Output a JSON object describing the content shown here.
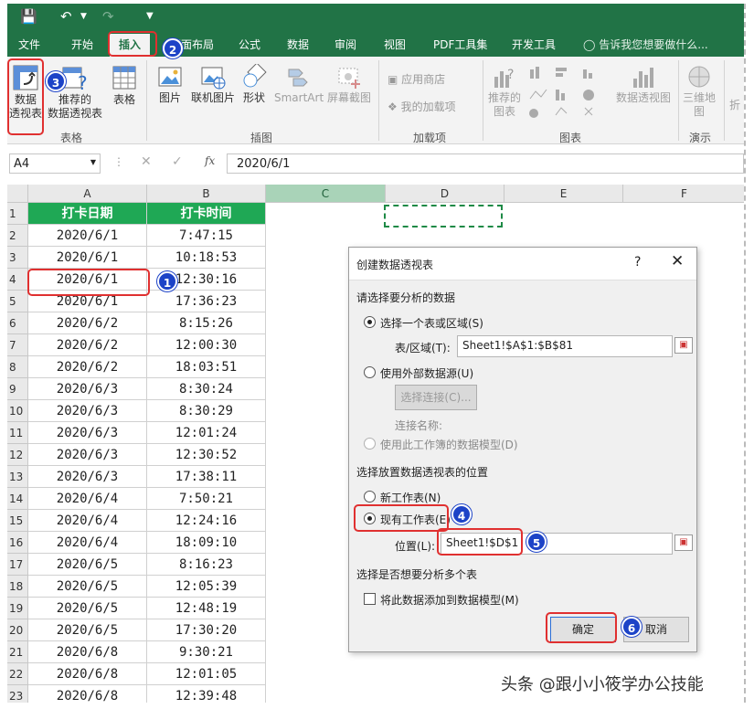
{
  "ribbon_tabs": [
    "文件",
    "开始",
    "插入",
    "页面布局",
    "公式",
    "数据",
    "审阅",
    "视图",
    "PDF工具集",
    "开发工具"
  ],
  "tell_me": "告诉我您想要做什么...",
  "ribbon": {
    "pivot": [
      "数据",
      "透视表"
    ],
    "recommended_pivot": [
      "推荐的",
      "数据透视表"
    ],
    "table": "表格",
    "group_tables": "表格",
    "picture": "图片",
    "online_picture": "联机图片",
    "shapes": "形状",
    "smartart": "SmartArt",
    "screenshot": "屏幕截图",
    "group_illustrations": "插图",
    "store": "应用商店",
    "my_addins": "我的加载项",
    "group_addins": "加载项",
    "rec_charts": [
      "推荐的",
      "图表"
    ],
    "pivot_chart": "数据透视图",
    "group_charts": "图表",
    "map3d": [
      "三维地",
      "图"
    ],
    "group_tours": "演示",
    "fold": "折"
  },
  "name_box": "A4",
  "formula": "2020/6/1",
  "columns": [
    "A",
    "B",
    "C",
    "D",
    "E",
    "F"
  ],
  "header_row": [
    "打卡日期",
    "打卡时间"
  ],
  "rows": [
    [
      "2020/6/1",
      "7:47:15"
    ],
    [
      "2020/6/1",
      "10:18:53"
    ],
    [
      "2020/6/1",
      "12:30:16"
    ],
    [
      "2020/6/1",
      "17:36:23"
    ],
    [
      "2020/6/2",
      "8:15:26"
    ],
    [
      "2020/6/2",
      "12:00:30"
    ],
    [
      "2020/6/2",
      "18:03:51"
    ],
    [
      "2020/6/3",
      "8:30:24"
    ],
    [
      "2020/6/3",
      "8:30:29"
    ],
    [
      "2020/6/3",
      "12:01:24"
    ],
    [
      "2020/6/3",
      "12:30:52"
    ],
    [
      "2020/6/3",
      "17:38:11"
    ],
    [
      "2020/6/4",
      "7:50:21"
    ],
    [
      "2020/6/4",
      "12:24:16"
    ],
    [
      "2020/6/4",
      "18:09:10"
    ],
    [
      "2020/6/5",
      "8:16:23"
    ],
    [
      "2020/6/5",
      "12:05:39"
    ],
    [
      "2020/6/5",
      "12:48:19"
    ],
    [
      "2020/6/5",
      "17:30:20"
    ],
    [
      "2020/6/8",
      "9:30:21"
    ],
    [
      "2020/6/8",
      "12:01:05"
    ],
    [
      "2020/6/8",
      "12:39:48"
    ]
  ],
  "row_numbers": [
    "1",
    "2",
    "3",
    "4",
    "5",
    "6",
    "7",
    "8",
    "9",
    "10",
    "11",
    "12",
    "13",
    "14",
    "15",
    "16",
    "17",
    "18",
    "19",
    "20",
    "21",
    "22",
    "23"
  ],
  "dialog": {
    "title": "创建数据透视表",
    "help": "?",
    "close": "✕",
    "section1": "请选择要分析的数据",
    "opt_range": "选择一个表或区域(S)",
    "range_label": "表/区域(T):",
    "range_value": "Sheet1!$A$1:$B$81",
    "opt_external": "使用外部数据源(U)",
    "choose_conn": "选择连接(C)...",
    "conn_name": "连接名称:",
    "opt_model": "使用此工作簿的数据模型(D)",
    "section2": "选择放置数据透视表的位置",
    "opt_new": "新工作表(N)",
    "opt_existing": "现有工作表(E)",
    "loc_label": "位置(L):",
    "loc_value": "Sheet1!$D$1",
    "section3": "选择是否想要分析多个表",
    "add_model": "将此数据添加到数据模型(M)",
    "ok": "确定",
    "cancel": "取消"
  },
  "markers": [
    "1",
    "2",
    "3",
    "4",
    "5",
    "6"
  ],
  "watermark": "头条 @跟小小筱学办公技能",
  "colors": {
    "excel_green": "#217346",
    "header_fill": "#1fa855",
    "marker_blue": "#1d43c7",
    "highlight_red": "#e03030"
  }
}
